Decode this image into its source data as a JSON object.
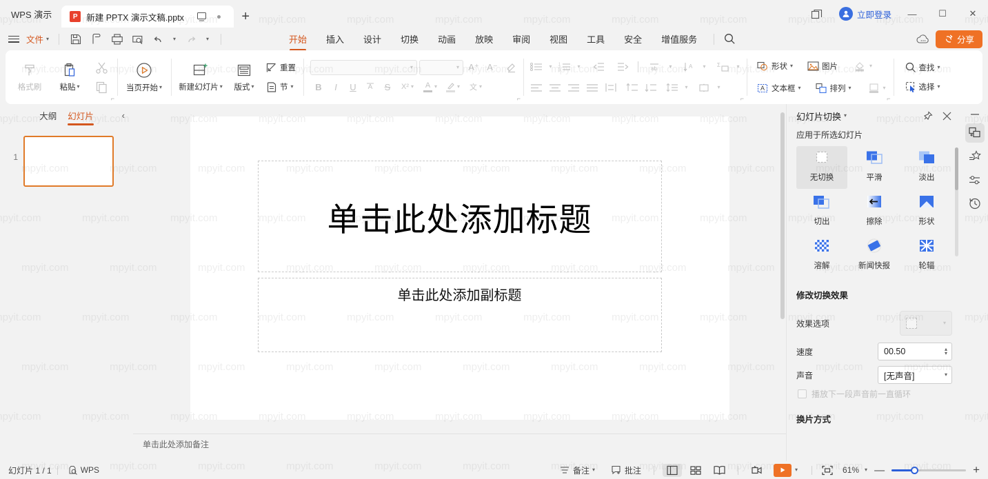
{
  "titlebar": {
    "brand": "WPS 演示",
    "tab_title": "新建 PPTX 演示文稿.pptx",
    "tab_icon_letter": "P",
    "new_tab": "+",
    "login_text": "立即登录",
    "minimize": "—",
    "maximize": "☐",
    "close": "✕"
  },
  "menubar": {
    "file": "文件",
    "quick_icons": [
      "save-icon",
      "save-as-cloud-icon",
      "print-icon",
      "print-preview-icon",
      "undo-icon",
      "redo-icon",
      "more-icon"
    ],
    "tabs": [
      {
        "label": "开始",
        "active": true
      },
      {
        "label": "插入",
        "active": false
      },
      {
        "label": "设计",
        "active": false
      },
      {
        "label": "切换",
        "active": false
      },
      {
        "label": "动画",
        "active": false
      },
      {
        "label": "放映",
        "active": false
      },
      {
        "label": "审阅",
        "active": false
      },
      {
        "label": "视图",
        "active": false
      },
      {
        "label": "工具",
        "active": false
      },
      {
        "label": "安全",
        "active": false
      },
      {
        "label": "增值服务",
        "active": false
      }
    ],
    "search_icon": "search-icon",
    "help_icon": "help-cloud-icon",
    "share": "分享"
  },
  "ribbon": {
    "format_painter": "格式刷",
    "paste": "粘贴",
    "copy_icon": "copy-icon",
    "cut_icon": "cut-icon",
    "start_from_current": "当页开始",
    "new_slide": "新建幻灯片",
    "layout": "版式",
    "reset": "重置",
    "section": "节",
    "font_name": "",
    "font_size": "",
    "grow_font": "A⁺",
    "shrink_font": "A⁻",
    "clear_format": "clear-format-icon",
    "bold": "B",
    "italic": "I",
    "underline": "U",
    "char_border": "A",
    "strikethrough": "S",
    "superscript": "X²",
    "font_color": "A",
    "highlight": "highlight-icon",
    "pinyin": "文",
    "bullets_icon": "bullets-icon",
    "numbering_icon": "numbering-icon",
    "decrease_indent_icon": "decrease-indent-icon",
    "increase_indent_icon": "increase-indent-icon",
    "text_direction_icon": "text-direction-icon",
    "align_text_icon": "align-text-icon",
    "smartart_icon": "smartart-icon",
    "align_left_icon": "align-left-icon",
    "align_center_icon": "align-center-icon",
    "align_right_icon": "align-right-icon",
    "justify_icon": "justify-icon",
    "distribute_icon": "distribute-icon",
    "line_spacing_up_icon": "line-spacing-up-icon",
    "line_spacing_down_icon": "line-spacing-down-icon",
    "line_spacing_icon": "line-spacing-icon",
    "column_icon": "column-icon",
    "shapes": "形状",
    "picture": "图片",
    "textbox": "文本框",
    "arrange": "排列",
    "shape_fill_icon": "shape-fill-icon",
    "shape_style_icon": "shape-style-icon",
    "find": "查找",
    "select": "选择"
  },
  "leftpane": {
    "tab_outline": "大纲",
    "tab_slides": "幻灯片",
    "collapse_icon": "chevron-left-icon",
    "slides": [
      {
        "number": "1"
      }
    ]
  },
  "slide": {
    "title_placeholder": "单击此处添加标题",
    "subtitle_placeholder": "单击此处添加副标题",
    "notes_placeholder": "单击此处添加备注"
  },
  "rightpane": {
    "title": "幻灯片切换",
    "pin_icon": "pin-icon",
    "close_icon": "close-icon",
    "apply_label": "应用于所选幻灯片",
    "effects": [
      {
        "name": "无切换",
        "icon": "none-transition-icon",
        "selected": true
      },
      {
        "name": "平滑",
        "icon": "morph-icon",
        "selected": false
      },
      {
        "name": "淡出",
        "icon": "fade-icon",
        "selected": false
      },
      {
        "name": "切出",
        "icon": "cut-transition-icon",
        "selected": false
      },
      {
        "name": "擦除",
        "icon": "wipe-icon",
        "selected": false
      },
      {
        "name": "形状",
        "icon": "shape-transition-icon",
        "selected": false
      },
      {
        "name": "溶解",
        "icon": "dissolve-icon",
        "selected": false
      },
      {
        "name": "新闻快报",
        "icon": "newsflash-icon",
        "selected": false
      },
      {
        "name": "轮辐",
        "icon": "wheel-icon",
        "selected": false
      }
    ],
    "modify_section": "修改切换效果",
    "effect_options_label": "效果选项",
    "speed_label": "速度",
    "speed_value": "00.50",
    "sound_label": "声音",
    "sound_value": "[无声音]",
    "loop_label": "播放下一段声音前一直循环",
    "advance_section": "换片方式"
  },
  "rail": {
    "items": [
      {
        "name": "transition-panel-icon",
        "active": true
      },
      {
        "name": "design-ideas-icon",
        "active": false
      },
      {
        "name": "properties-icon",
        "active": false
      },
      {
        "name": "history-icon",
        "active": false
      }
    ]
  },
  "statusbar": {
    "slide_count": "幻灯片 1 / 1",
    "wps_label": "WPS",
    "notes": "备注",
    "comments": "批注",
    "view_normal_icon": "normal-view-icon",
    "view_sorter_icon": "slide-sorter-icon",
    "view_reading_icon": "reading-view-icon",
    "present_mode_icon": "present-record-icon",
    "play_icon": "play-icon",
    "fit_icon": "fit-to-window-icon",
    "zoom": "61%",
    "zoom_out": "—",
    "zoom_in": "+"
  },
  "watermark": {
    "text": "mpyit.com"
  },
  "colors": {
    "accent_orange": "#d4571e",
    "share_orange": "#ef7125",
    "link_blue": "#2b5fd9",
    "panel_bg": "#f2f2f2",
    "transition_blue": "#3a72e8"
  }
}
